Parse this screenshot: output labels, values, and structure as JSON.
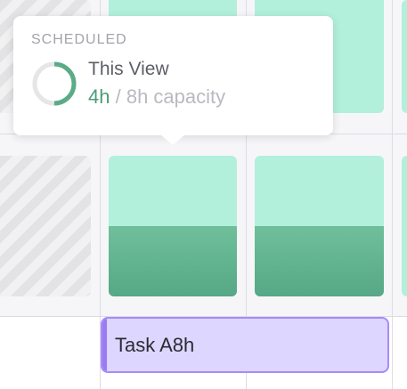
{
  "tooltip": {
    "heading": "SCHEDULED",
    "view_label": "This View",
    "scheduled_hours": "4h",
    "separator": " / ",
    "capacity_text": "8h capacity",
    "progress_fraction": 0.5
  },
  "task": {
    "label": "Task A8h"
  },
  "colors": {
    "available": "#b2f0dc",
    "booked": "#5aac89",
    "task_bg": "#ddd6fe",
    "task_border": "#a78bfa",
    "scheduled_text": "#4a9c78"
  }
}
